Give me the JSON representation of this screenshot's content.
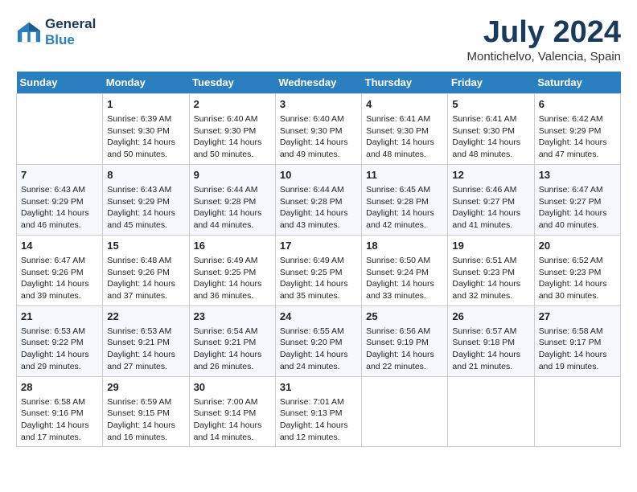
{
  "header": {
    "logo_line1": "General",
    "logo_line2": "Blue",
    "month_year": "July 2024",
    "location": "Montichelvo, Valencia, Spain"
  },
  "days_of_week": [
    "Sunday",
    "Monday",
    "Tuesday",
    "Wednesday",
    "Thursday",
    "Friday",
    "Saturday"
  ],
  "weeks": [
    [
      {
        "day": "",
        "info": ""
      },
      {
        "day": "1",
        "info": "Sunrise: 6:39 AM\nSunset: 9:30 PM\nDaylight: 14 hours\nand 50 minutes."
      },
      {
        "day": "2",
        "info": "Sunrise: 6:40 AM\nSunset: 9:30 PM\nDaylight: 14 hours\nand 50 minutes."
      },
      {
        "day": "3",
        "info": "Sunrise: 6:40 AM\nSunset: 9:30 PM\nDaylight: 14 hours\nand 49 minutes."
      },
      {
        "day": "4",
        "info": "Sunrise: 6:41 AM\nSunset: 9:30 PM\nDaylight: 14 hours\nand 48 minutes."
      },
      {
        "day": "5",
        "info": "Sunrise: 6:41 AM\nSunset: 9:30 PM\nDaylight: 14 hours\nand 48 minutes."
      },
      {
        "day": "6",
        "info": "Sunrise: 6:42 AM\nSunset: 9:29 PM\nDaylight: 14 hours\nand 47 minutes."
      }
    ],
    [
      {
        "day": "7",
        "info": "Sunrise: 6:43 AM\nSunset: 9:29 PM\nDaylight: 14 hours\nand 46 minutes."
      },
      {
        "day": "8",
        "info": "Sunrise: 6:43 AM\nSunset: 9:29 PM\nDaylight: 14 hours\nand 45 minutes."
      },
      {
        "day": "9",
        "info": "Sunrise: 6:44 AM\nSunset: 9:28 PM\nDaylight: 14 hours\nand 44 minutes."
      },
      {
        "day": "10",
        "info": "Sunrise: 6:44 AM\nSunset: 9:28 PM\nDaylight: 14 hours\nand 43 minutes."
      },
      {
        "day": "11",
        "info": "Sunrise: 6:45 AM\nSunset: 9:28 PM\nDaylight: 14 hours\nand 42 minutes."
      },
      {
        "day": "12",
        "info": "Sunrise: 6:46 AM\nSunset: 9:27 PM\nDaylight: 14 hours\nand 41 minutes."
      },
      {
        "day": "13",
        "info": "Sunrise: 6:47 AM\nSunset: 9:27 PM\nDaylight: 14 hours\nand 40 minutes."
      }
    ],
    [
      {
        "day": "14",
        "info": "Sunrise: 6:47 AM\nSunset: 9:26 PM\nDaylight: 14 hours\nand 39 minutes."
      },
      {
        "day": "15",
        "info": "Sunrise: 6:48 AM\nSunset: 9:26 PM\nDaylight: 14 hours\nand 37 minutes."
      },
      {
        "day": "16",
        "info": "Sunrise: 6:49 AM\nSunset: 9:25 PM\nDaylight: 14 hours\nand 36 minutes."
      },
      {
        "day": "17",
        "info": "Sunrise: 6:49 AM\nSunset: 9:25 PM\nDaylight: 14 hours\nand 35 minutes."
      },
      {
        "day": "18",
        "info": "Sunrise: 6:50 AM\nSunset: 9:24 PM\nDaylight: 14 hours\nand 33 minutes."
      },
      {
        "day": "19",
        "info": "Sunrise: 6:51 AM\nSunset: 9:23 PM\nDaylight: 14 hours\nand 32 minutes."
      },
      {
        "day": "20",
        "info": "Sunrise: 6:52 AM\nSunset: 9:23 PM\nDaylight: 14 hours\nand 30 minutes."
      }
    ],
    [
      {
        "day": "21",
        "info": "Sunrise: 6:53 AM\nSunset: 9:22 PM\nDaylight: 14 hours\nand 29 minutes."
      },
      {
        "day": "22",
        "info": "Sunrise: 6:53 AM\nSunset: 9:21 PM\nDaylight: 14 hours\nand 27 minutes."
      },
      {
        "day": "23",
        "info": "Sunrise: 6:54 AM\nSunset: 9:21 PM\nDaylight: 14 hours\nand 26 minutes."
      },
      {
        "day": "24",
        "info": "Sunrise: 6:55 AM\nSunset: 9:20 PM\nDaylight: 14 hours\nand 24 minutes."
      },
      {
        "day": "25",
        "info": "Sunrise: 6:56 AM\nSunset: 9:19 PM\nDaylight: 14 hours\nand 22 minutes."
      },
      {
        "day": "26",
        "info": "Sunrise: 6:57 AM\nSunset: 9:18 PM\nDaylight: 14 hours\nand 21 minutes."
      },
      {
        "day": "27",
        "info": "Sunrise: 6:58 AM\nSunset: 9:17 PM\nDaylight: 14 hours\nand 19 minutes."
      }
    ],
    [
      {
        "day": "28",
        "info": "Sunrise: 6:58 AM\nSunset: 9:16 PM\nDaylight: 14 hours\nand 17 minutes."
      },
      {
        "day": "29",
        "info": "Sunrise: 6:59 AM\nSunset: 9:15 PM\nDaylight: 14 hours\nand 16 minutes."
      },
      {
        "day": "30",
        "info": "Sunrise: 7:00 AM\nSunset: 9:14 PM\nDaylight: 14 hours\nand 14 minutes."
      },
      {
        "day": "31",
        "info": "Sunrise: 7:01 AM\nSunset: 9:13 PM\nDaylight: 14 hours\nand 12 minutes."
      },
      {
        "day": "",
        "info": ""
      },
      {
        "day": "",
        "info": ""
      },
      {
        "day": "",
        "info": ""
      }
    ]
  ]
}
